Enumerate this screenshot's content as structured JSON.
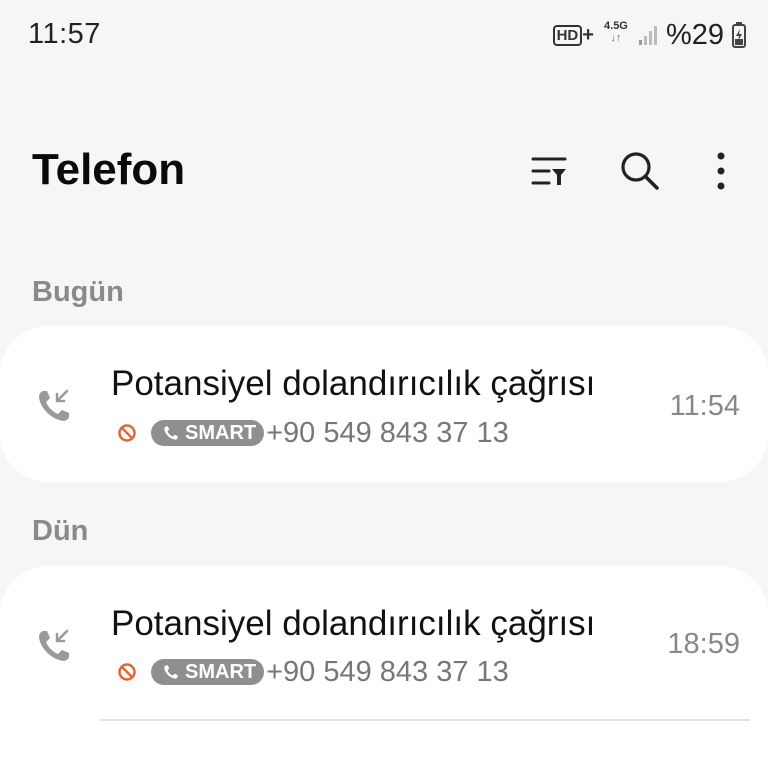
{
  "status_bar": {
    "time": "11:57",
    "hd_label": "HD",
    "hd_plus": "+",
    "network_type": "4.5G",
    "network_arrows": "↓↑",
    "battery_percent": "%29",
    "icons": [
      "hd-voice-icon",
      "network-4-5g-icon",
      "signal-icon",
      "battery-charging-icon"
    ]
  },
  "header": {
    "title": "Telefon",
    "icons": [
      "filter-icon",
      "search-icon",
      "more-options-icon"
    ]
  },
  "sections": [
    {
      "label": "Bugün",
      "calls": [
        {
          "name": "Potansiyel dolandırıcılık çağrısı",
          "badge": "SMART",
          "number": "+90 549 843 37 13",
          "time": "11:54"
        }
      ]
    },
    {
      "label": "Dün",
      "calls": [
        {
          "name": "Potansiyel dolandırıcılık çağrısı",
          "badge": "SMART",
          "number": "+90 549 843 37 13",
          "time": "18:59"
        }
      ]
    }
  ],
  "colors": {
    "background": "#f6f6f6",
    "card": "#ffffff",
    "block_icon": "#e0663a",
    "badge": "#8f8f8f",
    "secondary_text": "#777777"
  }
}
